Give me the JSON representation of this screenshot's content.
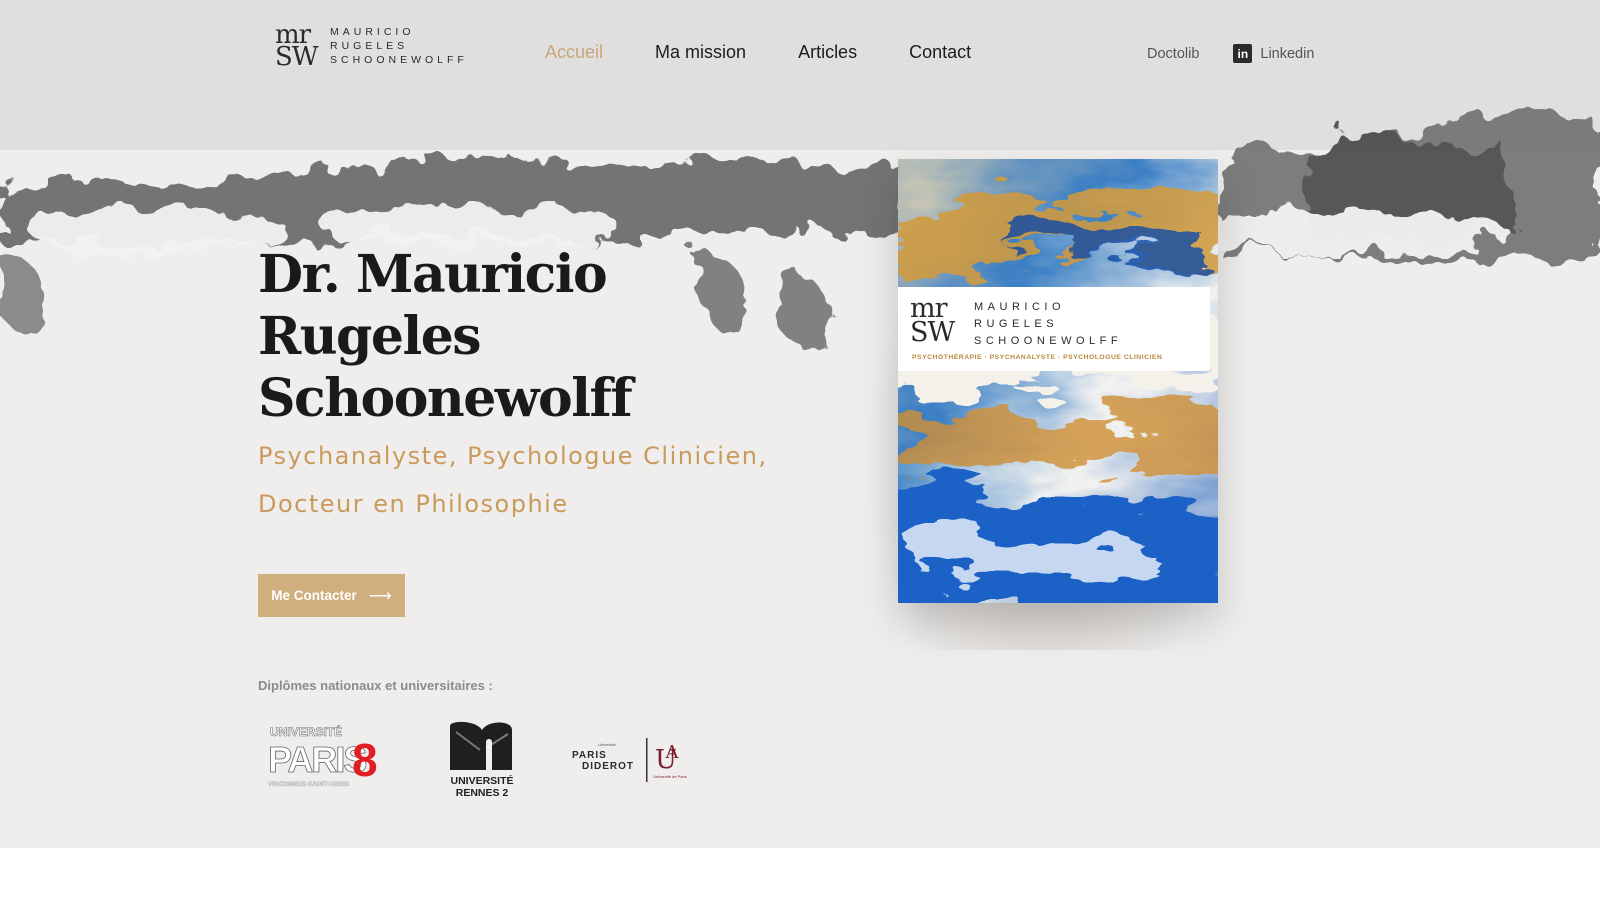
{
  "header": {
    "logo": {
      "mark": [
        "mr",
        "SW"
      ],
      "words": [
        "MAURICIO",
        "RUGELES",
        "SCHOONEWOLFF"
      ]
    },
    "nav": [
      {
        "label": "Accueil",
        "active": true
      },
      {
        "label": "Ma mission",
        "active": false
      },
      {
        "label": "Articles",
        "active": false
      },
      {
        "label": "Contact",
        "active": false
      }
    ],
    "external": {
      "doctolib": "Doctolib",
      "linkedin": "Linkedin",
      "linkedin_icon_text": "in"
    }
  },
  "hero": {
    "title": "Dr. Mauricio Rugeles Schoonewolff",
    "subtitle": "Psychanalyste, Psychologue Clinicien, Docteur en Philosophie",
    "cta_label": "Me Contacter",
    "cta_arrow": "⟶",
    "diplomas_label": "Diplômes nationaux et universitaires :",
    "universities": {
      "paris8": {
        "top": "UNIVERSITÉ",
        "name": "PARIS",
        "num": "8",
        "sub": "VINCENNES-SAINT-DENIS"
      },
      "rennes2": {
        "line1": "UNIVERSITÉ",
        "line2": "RENNES 2"
      },
      "diderot": {
        "small": "Université",
        "line1": "PARIS",
        "line2": "DIDEROT",
        "tag": "Université de Paris"
      }
    }
  },
  "book": {
    "mark": [
      "mr",
      "SW"
    ],
    "words": [
      "MAURICIO",
      "RUGELES",
      "SCHOONEWOLFF"
    ],
    "tagline": "PSYCHOTHÉRAPIE · PSYCHANALYSTE · PSYCHOLOGUE CLINICIEN"
  },
  "colors": {
    "accent": "#c99a5c",
    "button": "#d0ae7d",
    "ink": "#1a1a1a",
    "background": "#efeeed"
  }
}
